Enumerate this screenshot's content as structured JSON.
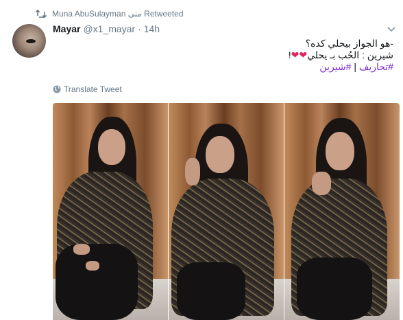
{
  "retweet": {
    "text": "Muna AbuSulayman منى Retweeted"
  },
  "tweet": {
    "author_name": "Mayar",
    "author_handle": "@x1_mayar",
    "time": "· 14h",
    "lines": [
      "-هو الجواز بيحلي كده؟",
      "شيرين : الحُب بـ يحلي"
    ],
    "hearts": "❤❤",
    "line2_end": "!",
    "hashtags": [
      "#تحاريف",
      "#شيرين"
    ],
    "hashtag_separator": "|",
    "translate_label": "Translate Tweet"
  },
  "media": {
    "photos": [
      {
        "alt": "photo-1"
      },
      {
        "alt": "photo-2"
      },
      {
        "alt": "photo-3"
      }
    ]
  },
  "colors": {
    "secondary_text": "#657786",
    "hashtag": "#7b2cc9",
    "heart": "#e0245e"
  }
}
